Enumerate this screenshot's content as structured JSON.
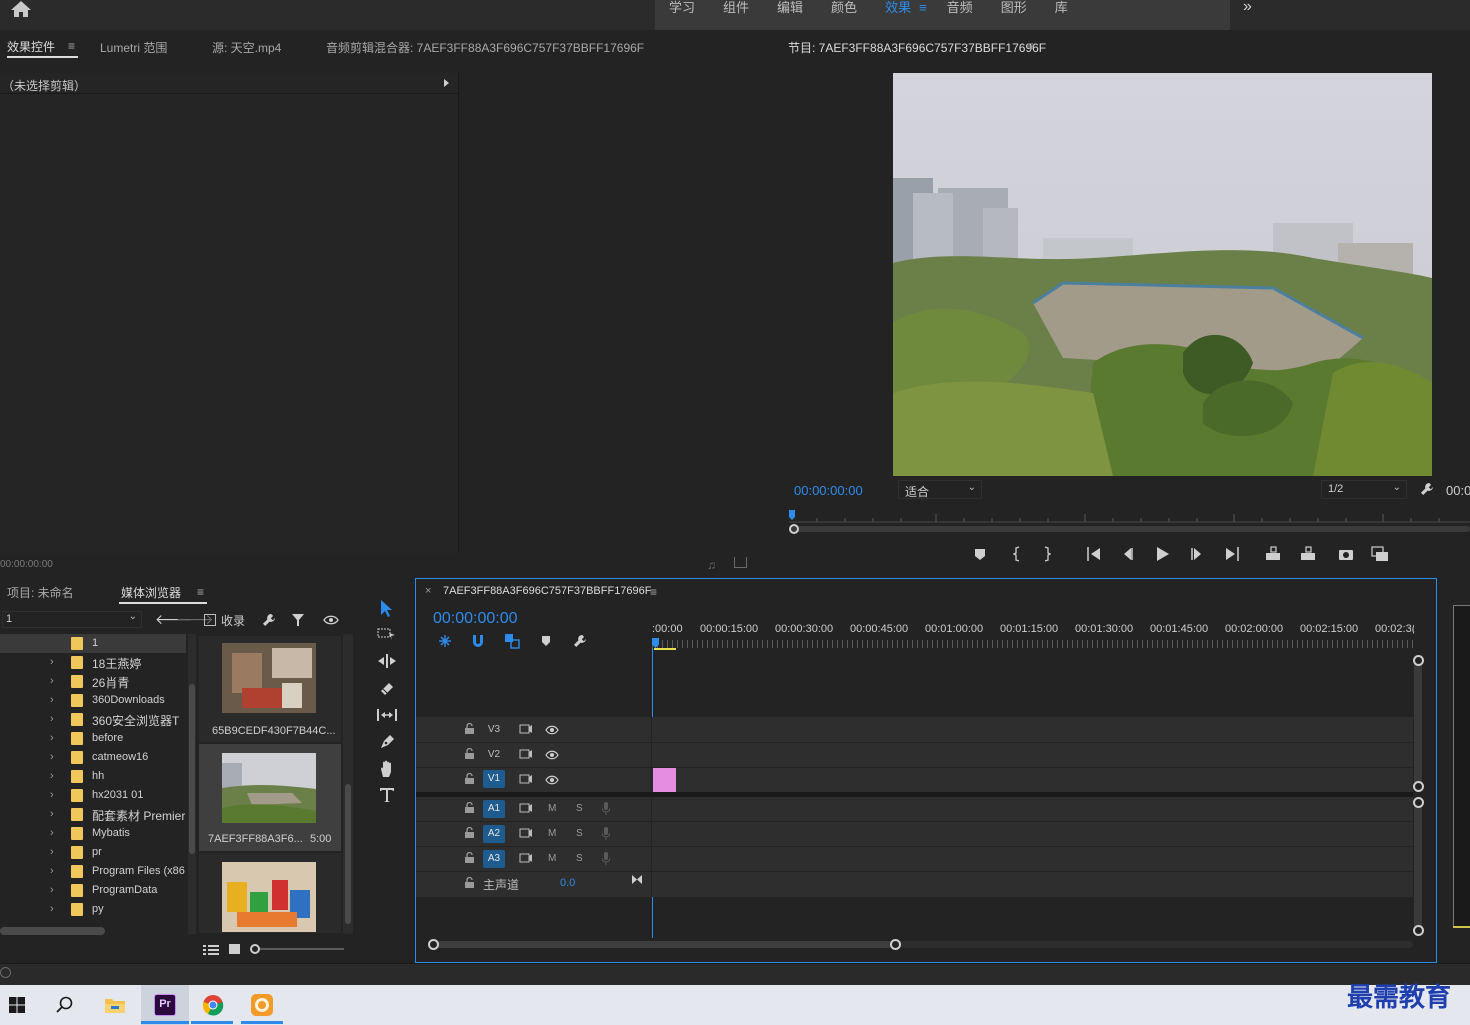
{
  "workspaces": {
    "tabs": [
      "学习",
      "组件",
      "编辑",
      "颜色",
      "效果",
      "音频",
      "图形",
      "库"
    ],
    "active_index": 4,
    "active_menu": "≡",
    "overflow": "»"
  },
  "effect_panel": {
    "tabs": [
      "效果控件",
      "Lumetri 范围",
      "源: 天空.mp4",
      "音频剪辑混合器: 7AEF3FF88A3F696C757F37BBFF17696F"
    ],
    "menu": "≡",
    "no_clip": "（未选择剪辑）",
    "timecode": "00:00:00:00"
  },
  "program_monitor": {
    "title": "节目: 7AEF3FF88A3F696C757F37BBFF17696F",
    "menu": "≡",
    "timecode": "00:00:00:00",
    "zoom": "适合",
    "resolution": "1/2",
    "right_timecode": "00:0"
  },
  "project_panel": {
    "tabs": [
      "项目: 未命名",
      "媒体浏览器"
    ],
    "menu": "≡",
    "path_value": "1",
    "ingest_label": "收录",
    "folders": [
      "1",
      "18王燕婷",
      "26肖青",
      "360Downloads",
      "360安全浏览器T",
      "before",
      "catmeow16",
      "hh",
      "hx2031 01",
      "配套素材 Premier",
      "Mybatis",
      "pr",
      "Program Files (x86",
      "ProgramData",
      "py"
    ],
    "thumbnails": [
      {
        "name": "65B9CEDF430F7B44C...",
        "duration": ""
      },
      {
        "name": "7AEF3FF88A3F6...",
        "duration": "5:00"
      },
      {
        "name": "",
        "duration": ""
      }
    ]
  },
  "timeline": {
    "sequence_name": "7AEF3FF88A3F696C757F37BBFF17696F",
    "close": "×",
    "menu": "≡",
    "timecode": "00:00:00:00",
    "ruler": [
      ":00:00",
      "00:00:15:00",
      "00:00:30:00",
      "00:00:45:00",
      "00:01:00:00",
      "00:01:15:00",
      "00:01:30:00",
      "00:01:45:00",
      "00:02:00:00",
      "00:02:15:00",
      "00:02:3("
    ],
    "video_tracks": [
      "V3",
      "V2",
      "V1"
    ],
    "audio_tracks": [
      "A1",
      "A2",
      "A3"
    ],
    "mute_label": "M",
    "solo_label": "S",
    "master_label": "主声道",
    "master_value": "0.0",
    "clip_color": "#e58de0"
  },
  "watermark": "最需教育",
  "colors": {
    "accent": "#2d8ceb",
    "panel": "#232323",
    "bg": "#1d1d1d"
  }
}
